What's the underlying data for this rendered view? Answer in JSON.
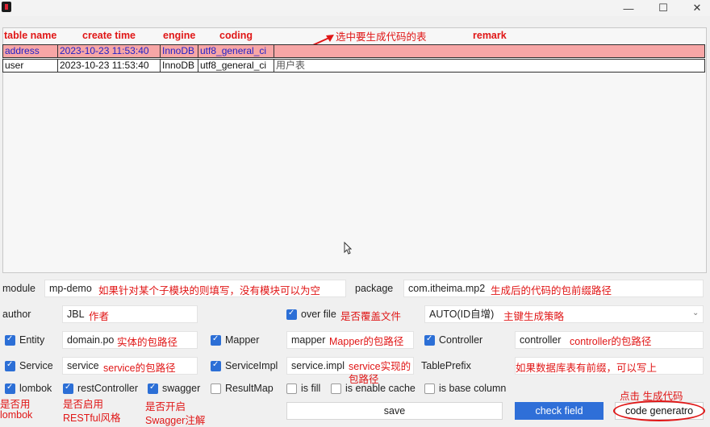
{
  "window": {
    "minimize": "—",
    "maximize": "☐",
    "close": "✕"
  },
  "table": {
    "headers": {
      "name": "table name",
      "create_time": "create time",
      "engine": "engine",
      "coding": "coding",
      "remark": "remark"
    },
    "rows": [
      {
        "name": "address",
        "create_time": "2023-10-23 11:53:40",
        "engine": "InnoDB",
        "coding": "utf8_general_ci",
        "remark": ""
      },
      {
        "name": "user",
        "create_time": "2023-10-23 11:53:40",
        "engine": "InnoDB",
        "coding": "utf8_general_ci",
        "remark": "用户表"
      }
    ],
    "annotation": "选中要生成代码的表"
  },
  "form": {
    "module": {
      "label": "module",
      "value": "mp-demo",
      "note": "如果针对某个子模块的则填写，没有模块可以为空"
    },
    "package": {
      "label": "package",
      "value": "com.itheima.mp2",
      "note": "生成后的代码的包前缀路径"
    },
    "author": {
      "label": "author",
      "value": "JBL",
      "note": "作者"
    },
    "over_file": {
      "label": "over file",
      "checked": true,
      "note": "是否覆盖文件"
    },
    "id_strategy": {
      "value": "AUTO(ID自增)",
      "note": "主键生成策略"
    },
    "entity": {
      "label": "Entity",
      "checked": true,
      "value": "domain.po",
      "note": "实体的包路径"
    },
    "mapper": {
      "label": "Mapper",
      "checked": true,
      "value": "mapper",
      "note": "Mapper的包路径"
    },
    "controller": {
      "label": "Controller",
      "checked": true,
      "value": "controller",
      "note": "controller的包路径"
    },
    "service": {
      "label": "Service",
      "checked": true,
      "value": "service",
      "note": "service的包路径"
    },
    "service_impl": {
      "label": "ServiceImpl",
      "checked": true,
      "value": "service.impl",
      "note_line1": "service实现的",
      "note_line2": "包路径"
    },
    "table_prefix": {
      "label": "TablePrefix",
      "value": "",
      "note": "如果数据库表有前缀，可以写上"
    },
    "lombok": {
      "label": "lombok",
      "checked": true,
      "note_line1": "是否用",
      "note_line2": "lombok"
    },
    "rest_controller": {
      "label": "restController",
      "checked": true,
      "note_line1": "是否启用",
      "note_line2": "RESTful风格"
    },
    "swagger": {
      "label": "swagger",
      "checked": true,
      "note_line1": "是否开启",
      "note_line2": "Swagger注解"
    },
    "result_map": {
      "label": "ResultMap",
      "checked": false
    },
    "is_fill": {
      "label": "is fill",
      "checked": false
    },
    "enable_cache": {
      "label": "is enable cache",
      "checked": false
    },
    "base_column": {
      "label": "is base column",
      "checked": false
    }
  },
  "buttons": {
    "save": "save",
    "check_field": "check field",
    "code_generator": "code generatro",
    "generator_note": "点击 生成代码"
  },
  "colors": {
    "annotation": "#e01616",
    "accent": "#2f6fd8",
    "selected_row": "#f7a6a6"
  }
}
